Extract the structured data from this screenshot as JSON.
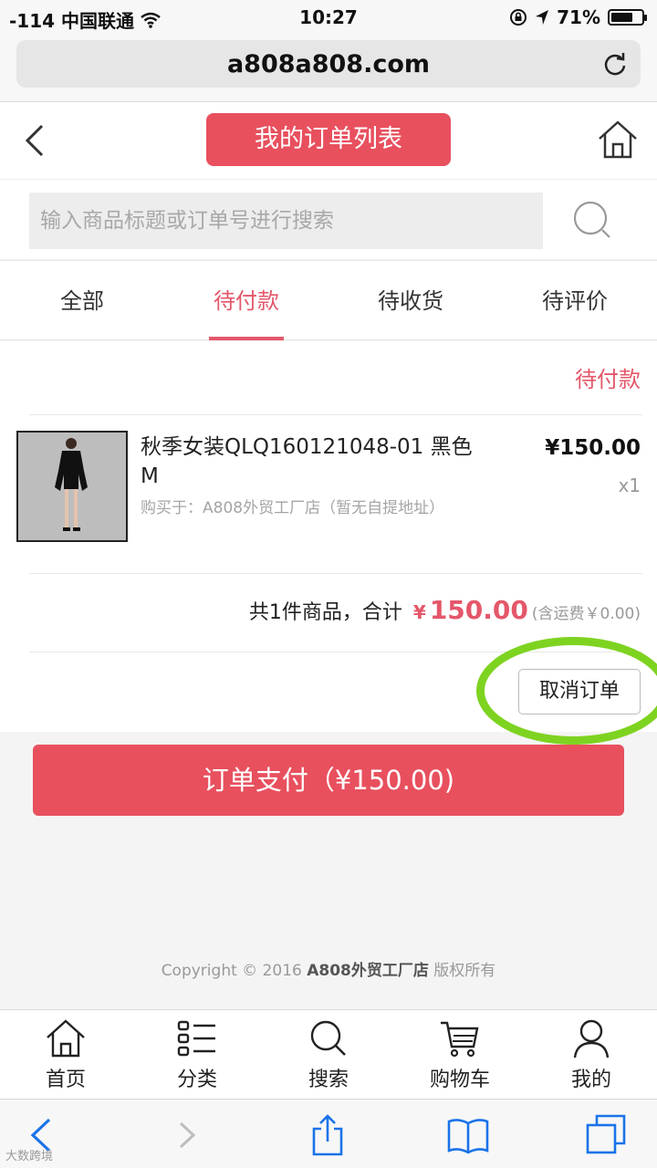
{
  "status_bar": {
    "carrier": "-114 中国联通",
    "time": "10:27",
    "battery_pct": "71%",
    "battery_level": 0.71
  },
  "browser": {
    "url": "a808a808.com"
  },
  "header": {
    "title": "我的订单列表"
  },
  "search": {
    "placeholder": "输入商品标题或订单号进行搜索"
  },
  "tabs": [
    {
      "label": "全部",
      "active": false
    },
    {
      "label": "待付款",
      "active": true
    },
    {
      "label": "待收货",
      "active": false
    },
    {
      "label": "待评价",
      "active": false
    }
  ],
  "order": {
    "status": "待付款",
    "product": {
      "title": "秋季女装QLQ160121048-01 黑色 M",
      "shop": "购买于：A808外贸工厂店（暂无自提地址）",
      "price": "¥150.00",
      "qty": "x1"
    },
    "summary": {
      "label": "共1件商品，合计",
      "yen": "¥",
      "amount": "150.00",
      "shipping": "(含运费￥0.00)"
    },
    "cancel_label": "取消订单"
  },
  "pay_button": "订单支付（¥150.00)",
  "footer": {
    "copyright_prefix": "Copyright © 2016",
    "brand": "A808外贸工厂店",
    "copyright_suffix": "版权所有"
  },
  "bottom_nav": [
    {
      "label": "首页",
      "icon": "home-icon"
    },
    {
      "label": "分类",
      "icon": "category-icon"
    },
    {
      "label": "搜索",
      "icon": "search-icon"
    },
    {
      "label": "购物车",
      "icon": "cart-icon"
    },
    {
      "label": "我的",
      "icon": "profile-icon"
    }
  ],
  "watermark": "大数跨境",
  "colors": {
    "accent": "#e8505e",
    "accent_text": "#e4576a",
    "highlight": "#7ed321"
  }
}
